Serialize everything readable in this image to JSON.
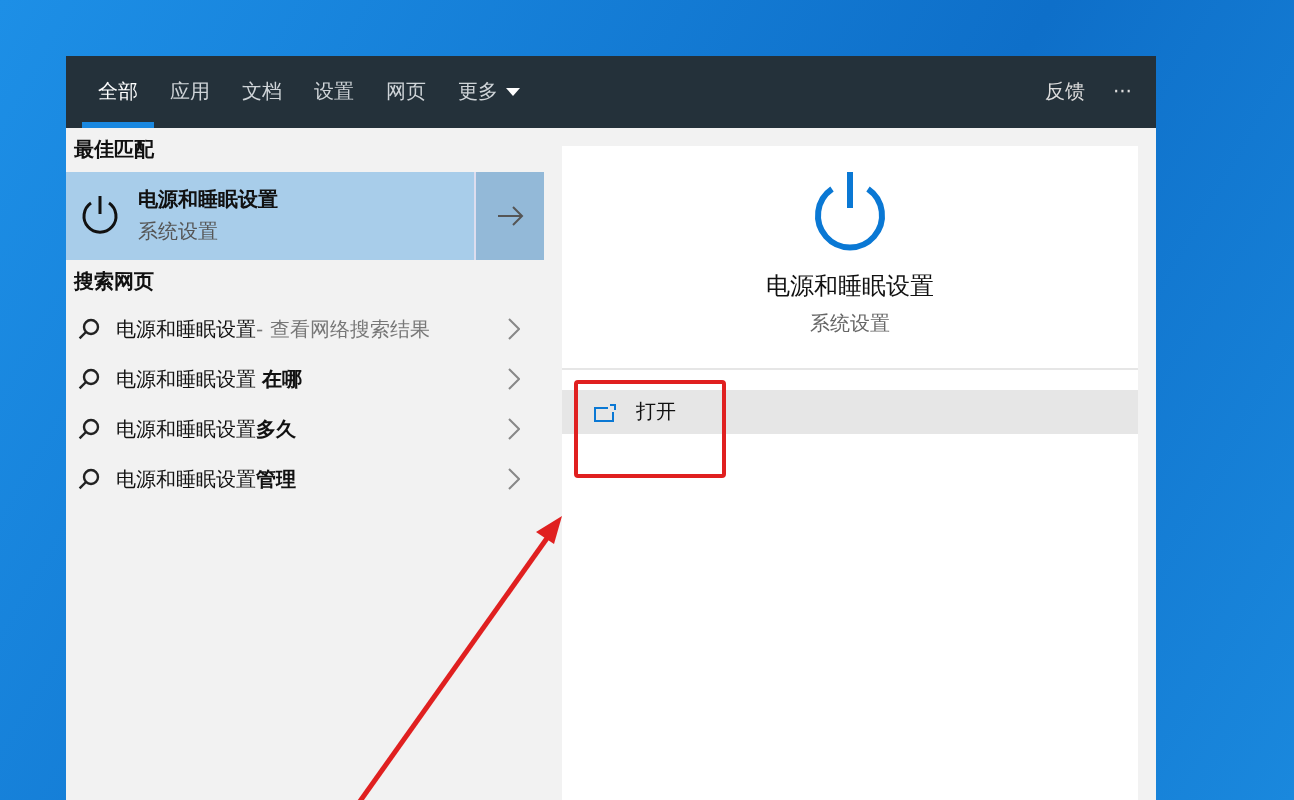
{
  "tabs": [
    {
      "label": "全部",
      "selected": true
    },
    {
      "label": "应用",
      "selected": false
    },
    {
      "label": "文档",
      "selected": false
    },
    {
      "label": "设置",
      "selected": false
    },
    {
      "label": "网页",
      "selected": false
    },
    {
      "label": "更多",
      "selected": false,
      "dropdown": true
    }
  ],
  "header_actions": {
    "feedback": "反馈",
    "more": "···"
  },
  "best_match": {
    "heading": "最佳匹配",
    "title": "电源和睡眠设置",
    "subtitle": "系统设置",
    "selected": true
  },
  "web_search": {
    "heading": "搜索网页",
    "items": [
      {
        "text": "电源和睡眠设置",
        "suffix": "- 查看网络搜索结果"
      },
      {
        "text": "电源和睡眠设置 **在哪**"
      },
      {
        "text": "电源和睡眠设置**多久**"
      },
      {
        "text": "电源和睡眠设置**管理**"
      }
    ]
  },
  "detail": {
    "title": "电源和睡眠设置",
    "subtitle": "系统设置",
    "actions": [
      {
        "label": "打开",
        "selected": true
      }
    ]
  },
  "annotations": {
    "highlight_box": true,
    "arrow": true
  }
}
